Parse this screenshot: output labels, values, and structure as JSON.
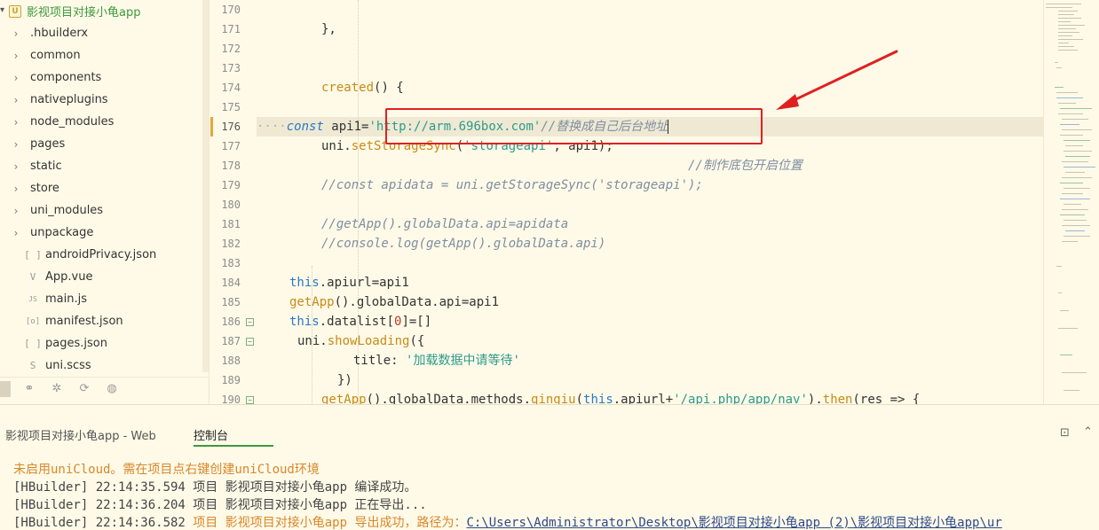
{
  "sidebar": {
    "project_name": "影视项目对接小龟app",
    "folders": [
      {
        "label": ".hbuilderx"
      },
      {
        "label": "common"
      },
      {
        "label": "components"
      },
      {
        "label": "nativeplugins"
      },
      {
        "label": "node_modules"
      },
      {
        "label": "pages"
      },
      {
        "label": "static"
      },
      {
        "label": "store"
      },
      {
        "label": "uni_modules"
      },
      {
        "label": "unpackage"
      }
    ],
    "files": [
      {
        "label": "androidPrivacy.json",
        "icon": "[ ]"
      },
      {
        "label": "App.vue",
        "icon": "V"
      },
      {
        "label": "main.js",
        "icon": "JS"
      },
      {
        "label": "manifest.json",
        "icon": "[o]"
      },
      {
        "label": "pages.json",
        "icon": "[ ]"
      },
      {
        "label": "uni.scss",
        "icon": "S"
      }
    ]
  },
  "editor": {
    "line_numbers": [
      "170",
      "171",
      "172",
      "173",
      "174",
      "175",
      "176",
      "177",
      "178",
      "179",
      "180",
      "181",
      "182",
      "183",
      "184",
      "185",
      "186",
      "187",
      "188",
      "189",
      "190"
    ],
    "current_line": "176",
    "fold_lines": [
      "186",
      "187",
      "190"
    ],
    "code": {
      "l171": "},",
      "l174_fn": "created",
      "l174_rest": "() {",
      "l176_dots": "····",
      "l176_kw": "const",
      "l176_var": " api1=",
      "l176_str": "'http://arm.696box.com'",
      "l176_cmt": "//替换成自己后台地址",
      "l177_pre": "uni.",
      "l177_fn": "setStorageSync",
      "l177_p1": "(",
      "l177_str": "'storageapi'",
      "l177_rest": ", api1);",
      "l178_cmt": "//制作底包开启位置",
      "l179_cmt": "//const apidata = uni.getStorageSync('storageapi');",
      "l181_cmt": "//getApp().globalData.api=apidata",
      "l182_cmt": "//console.log(getApp().globalData.api)",
      "l184_kw": "this",
      "l184_rest": ".apiurl=api1",
      "l185_fn": "getApp",
      "l185_rest": "().globalData.api=api1",
      "l186_kw": "this",
      "l186_rest1": ".datalist[",
      "l186_num": "0",
      "l186_rest2": "]=[]",
      "l187_pre": "uni.",
      "l187_fn": "showLoading",
      "l187_rest": "({",
      "l188_key": "title: ",
      "l188_str": "'加载数据中请等待'",
      "l189": "})",
      "l190_fn": "getApp",
      "l190_a": "().globalData.methods.",
      "l190_fn2": "qingiu",
      "l190_b": "(",
      "l190_kw": "this",
      "l190_c": ".apiurl+",
      "l190_str": "'/api.php/app/nav'",
      "l190_d": ").",
      "l190_fn3": "then",
      "l190_e": "(res => {"
    }
  },
  "console": {
    "title": "影视项目对接小龟app - Web",
    "tab": "控制台",
    "logs": {
      "warn": "未启用uniCloud。需在项目点右键创建uniCloud环境",
      "line1": "[HBuilder] 22:14:35.594 项目 影视项目对接小龟app 编译成功。",
      "line2": "[HBuilder] 22:14:36.204 项目 影视项目对接小龟app 正在导出...",
      "line3_prefix": "[HBuilder] 22:14:36.582 ",
      "line3_msg": "项目 影视项目对接小龟app 导出成功，路径为：",
      "line3_path": "C:\\Users\\Administrator\\Desktop\\影视项目对接小龟app (2)\\影视项目对接小龟app\\ur"
    }
  },
  "colors": {
    "background": "#fffae8",
    "keyword": "#2b78c8",
    "function": "#c88a16",
    "string": "#2d9b8a",
    "comment": "#7e8ea0",
    "annotation": "#e02020",
    "accent": "#3c9a3c"
  }
}
